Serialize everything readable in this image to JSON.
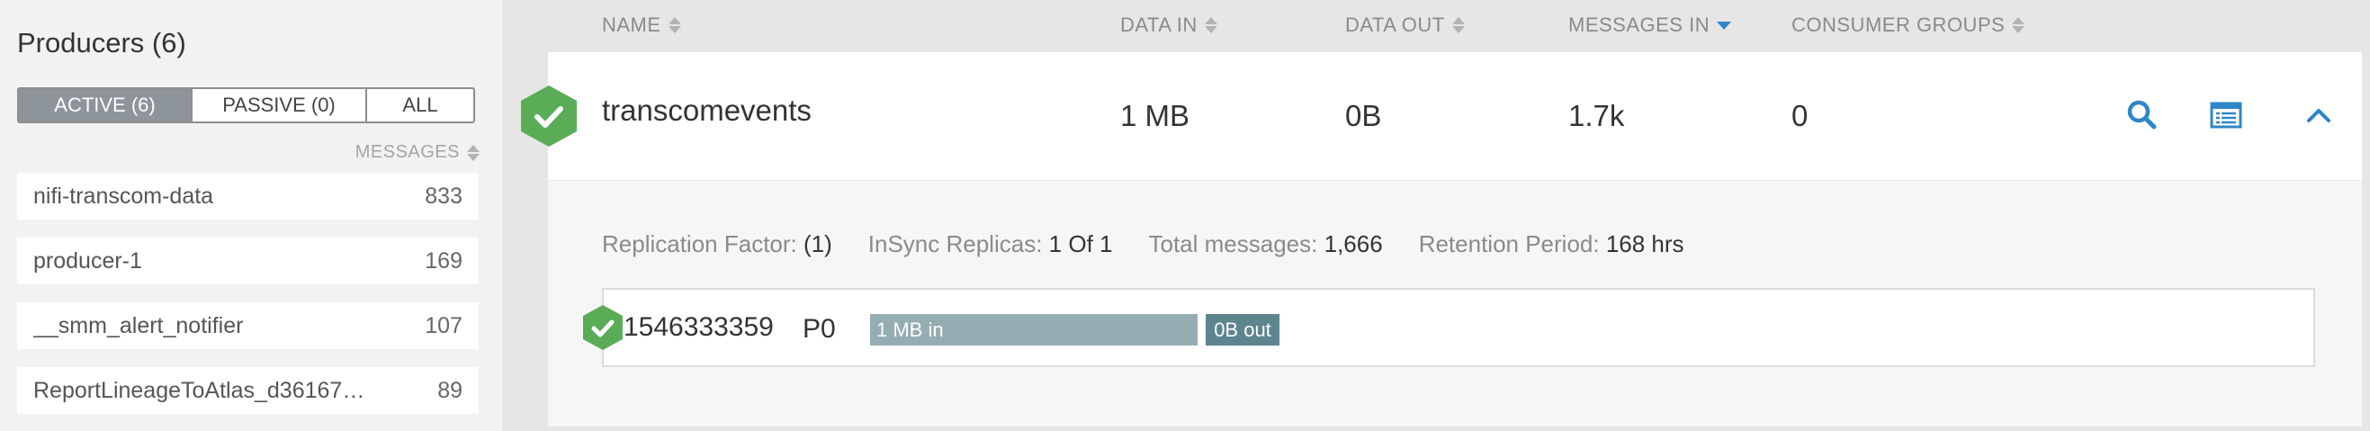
{
  "producers": {
    "title": "Producers (6)",
    "filters": [
      "ACTIVE (6)",
      "PASSIVE (0)",
      "ALL"
    ],
    "active_filter": "ACTIVE (6)",
    "messages_header": "MESSAGES",
    "items": [
      {
        "name": "nifi-transcom-data",
        "count": "833"
      },
      {
        "name": "producer-1",
        "count": "169"
      },
      {
        "name": "__smm_alert_notifier",
        "count": "107"
      },
      {
        "name": "ReportLineageToAtlas_d36167…",
        "count": "89"
      }
    ]
  },
  "columns": {
    "name": "NAME",
    "data_in": "DATA IN",
    "data_out": "DATA OUT",
    "messages_in": "MESSAGES IN",
    "consumer_groups": "CONSUMER GROUPS"
  },
  "topic": {
    "name": "transcomevents",
    "data_in": "1 MB",
    "data_out": "0B",
    "messages_in": "1.7k",
    "consumer_groups": "0",
    "icons": [
      "search-icon",
      "details-icon",
      "chevron-up-icon"
    ],
    "status_icon": "check-hexagon-icon",
    "meta": {
      "replication_label": "Replication Factor:",
      "replication_value": "(1)",
      "insync_label": "InSync Replicas:",
      "insync_value": "1 Of 1",
      "total_label": "Total messages:",
      "total_value": "1,666",
      "retention_label": "Retention Period:",
      "retention_value": "168 hrs"
    },
    "partition": {
      "id": "1546333359",
      "label": "P0",
      "in_label": "1 MB in",
      "out_label": "0B out"
    }
  },
  "colors": {
    "accent": "#2e86c8",
    "status_green": "#5aac57",
    "bar_in": "#94adb3",
    "bar_out": "#5d8590",
    "active_filter_bg": "#8d949a"
  }
}
